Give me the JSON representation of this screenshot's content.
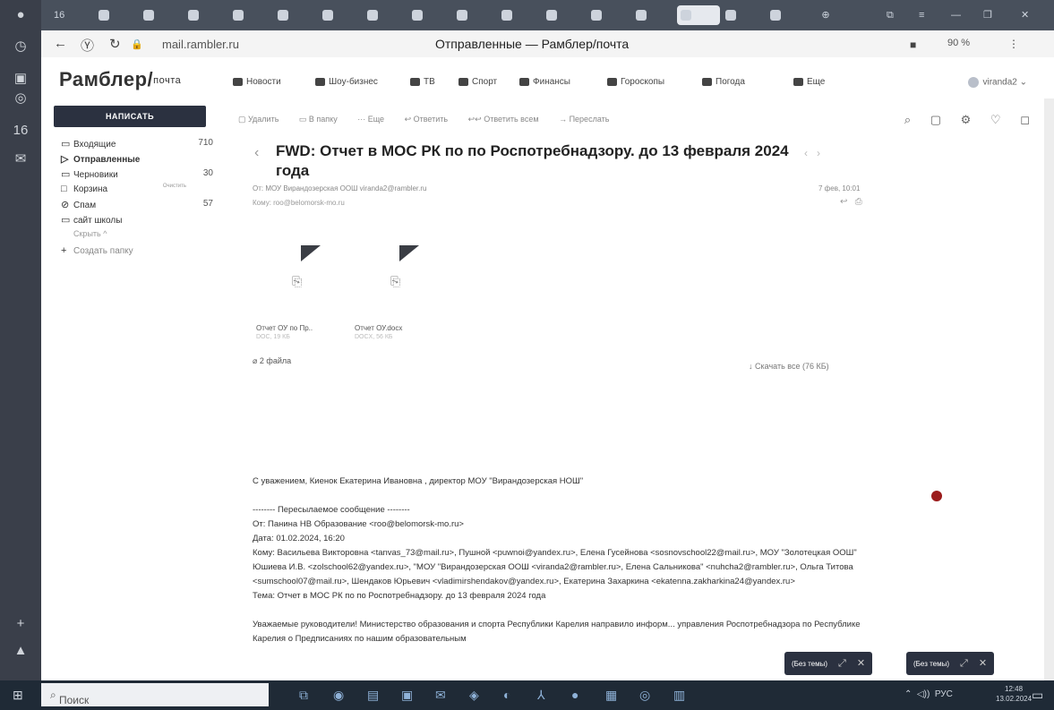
{
  "browser": {
    "url_host": "mail.rambler.ru",
    "page_title": "Отправленные — Рамблер/почта",
    "zoom": "90 %",
    "tab_count": "16"
  },
  "rambler": {
    "logo": "Рамблер/",
    "logo_suffix": "почта",
    "services": [
      "Новости",
      "Шоу-бизнес",
      "ТВ",
      "Спорт",
      "Финансы",
      "Гороскопы",
      "Погода",
      "Еще"
    ],
    "user": "viranda2"
  },
  "sidebar": {
    "compose": "НАПИСАТЬ",
    "folders": [
      {
        "label": "Входящие",
        "count": "710"
      },
      {
        "label": "Отправленные",
        "count": ""
      },
      {
        "label": "Черновики",
        "count": "30"
      },
      {
        "label": "Корзина",
        "count": "Очистить"
      },
      {
        "label": "Спам",
        "count": "57"
      },
      {
        "label": "сайт школы",
        "count": ""
      }
    ],
    "hide": "Скрыть",
    "create_folder": "Создать папку"
  },
  "toolbar": {
    "delete": "Удалить",
    "to_folder": "В папку",
    "more": "Еще",
    "reply": "Ответить",
    "reply_all": "Ответить всем",
    "forward": "Переслать"
  },
  "letter": {
    "subject": "FWD: Отчет в МОС РК по по Роспотребнадзору. до 13 февраля 2024 года",
    "from": "От: МОУ Вирандозерская ООШ viranda2@rambler.ru",
    "to": "Кому: roo@belomorsk-mo.ru",
    "date": "7 фев, 10:01",
    "attachments": [
      {
        "name": "Отчет ОУ по Пр..",
        "size": "DOC, 19 КБ"
      },
      {
        "name": "Отчет ОУ.docx",
        "size": "DOCX, 56 КБ"
      }
    ],
    "files_count": "2 файла",
    "download_all": "Скачать все (76 КБ)",
    "body": {
      "signature": "С уважением, Киенок Екатерина Ивановна , директор МОУ \"Вирандозерская НОШ\"",
      "fwd_header": "-------- Пересылаемое сообщение --------",
      "fwd_from": "От: Панина НВ Образование <roo@belomorsk-mo.ru>",
      "fwd_date": "Дата: 01.02.2024, 16:20",
      "fwd_to": "Кому: Васильева Викторовна <tanvas_73@mail.ru>, Пушной <puwnoi@yandex.ru>, Елена Гусейнова <sosnovschool22@mail.ru>, МОУ \"Золотецкая ООШ\" Юшиева И.В. <zolschool62@yandex.ru>, \"МОУ \"Вирандозерская ООШ <viranda2@rambler.ru>, Елена Сальникова\" <nuhcha2@rambler.ru>, Ольга Титова <sumschool07@mail.ru>, Шендаков Юрьевич <vladimirshendakov@yandex.ru>, Екатерина Захаркина <ekatenna.zakharkina24@yandex.ru>",
      "fwd_subject": "Тема: Отчет в МОС РК по по Роспотребнадзору. до 13 февраля 2024 года",
      "text": "Уважаемые руководители! Министерство образования и спорта Республики Карелия направило информ... управления Роспотребнадзора по Республике Карелия о Предписаниях по нашим образовательным"
    }
  },
  "popups": [
    "(Без темы)",
    "(Без темы)"
  ],
  "taskbar": {
    "search": "Поиск",
    "lang": "РУС",
    "time": "12:48",
    "date": "13.02.2024"
  }
}
